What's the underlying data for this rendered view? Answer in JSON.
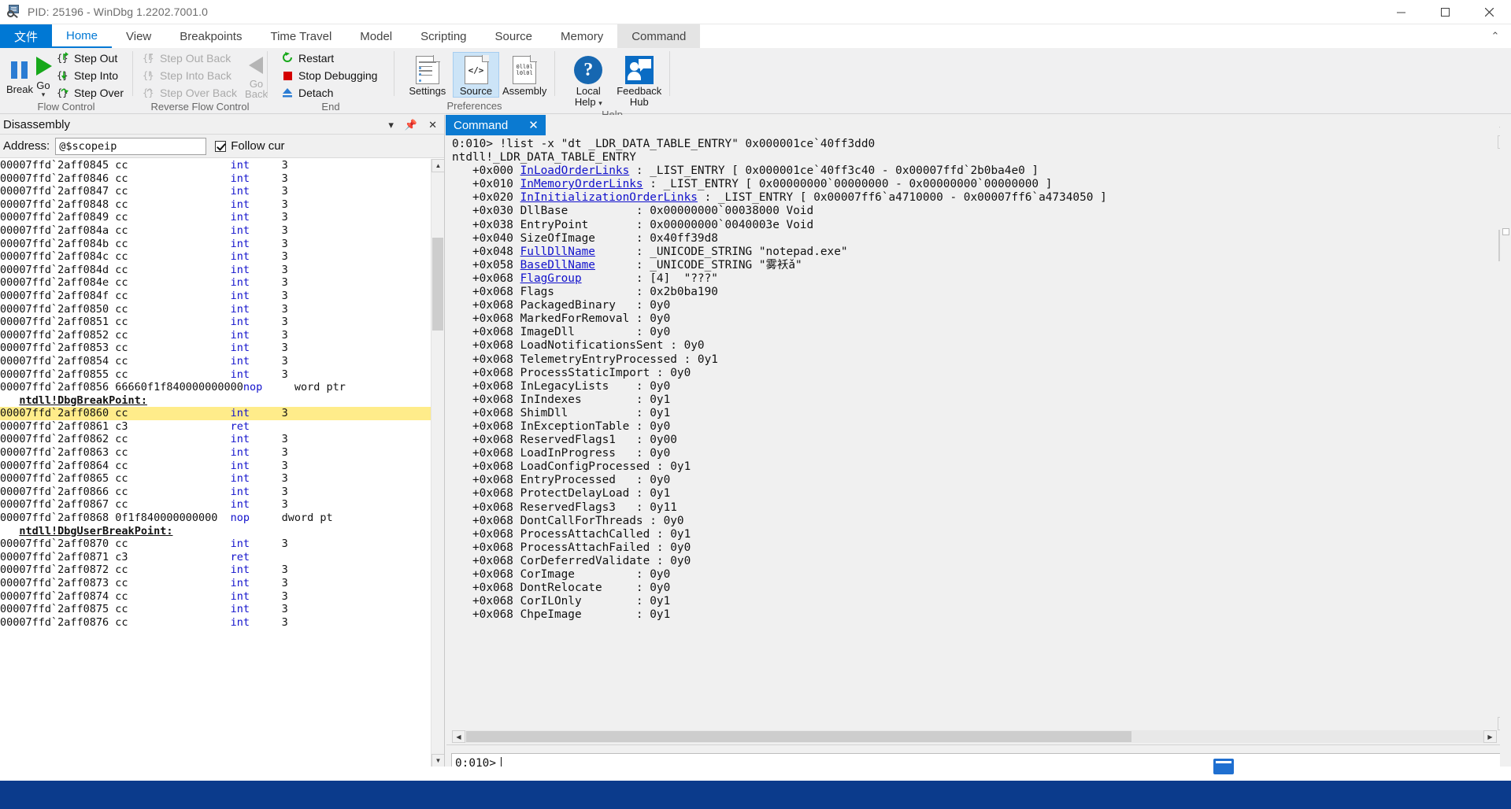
{
  "window": {
    "title": "PID: 25196 - WinDbg 1.2202.7001.0",
    "icon": "windbg-icon",
    "minimize": "minimize-button",
    "maximize": "maximize-button",
    "close": "close-button"
  },
  "ribbon": {
    "file_tab": "文件",
    "tabs": [
      {
        "label": "Home",
        "active": true
      },
      {
        "label": "View",
        "active": false
      },
      {
        "label": "Breakpoints",
        "active": false
      },
      {
        "label": "Time Travel",
        "active": false
      },
      {
        "label": "Model",
        "active": false
      },
      {
        "label": "Scripting",
        "active": false
      },
      {
        "label": "Source",
        "active": false
      },
      {
        "label": "Memory",
        "active": false
      },
      {
        "label": "Command",
        "active": false
      }
    ],
    "groups": [
      {
        "label": "Flow Control",
        "big": [
          {
            "label": "Break",
            "icon": "pause-icon",
            "enabled": true
          },
          {
            "label": "Go",
            "icon": "play-icon",
            "enabled": true,
            "dropdown": true
          }
        ],
        "small": [
          {
            "label": "Step Out",
            "icon": "step-out-icon",
            "enabled": true
          },
          {
            "label": "Step Into",
            "icon": "step-into-icon",
            "enabled": true
          },
          {
            "label": "Step Over",
            "icon": "step-over-icon",
            "enabled": true
          }
        ]
      },
      {
        "label": "Reverse Flow Control",
        "small": [
          {
            "label": "Step Out Back",
            "icon": "step-out-back-icon",
            "enabled": false
          },
          {
            "label": "Step Into Back",
            "icon": "step-into-back-icon",
            "enabled": false
          },
          {
            "label": "Step Over Back",
            "icon": "step-over-back-icon",
            "enabled": false
          }
        ],
        "big": [
          {
            "label": "Go Back",
            "icon": "go-back-icon",
            "enabled": false
          }
        ]
      },
      {
        "label": "End",
        "small": [
          {
            "label": "Restart",
            "icon": "restart-icon",
            "enabled": true
          },
          {
            "label": "Stop Debugging",
            "icon": "stop-icon",
            "enabled": true
          },
          {
            "label": "Detach",
            "icon": "detach-icon",
            "enabled": true
          }
        ]
      },
      {
        "label": "Preferences",
        "pbtns": [
          {
            "label": "Settings",
            "icon": "settings-doc-icon",
            "selected": false
          },
          {
            "label": "Source",
            "icon": "source-code-icon",
            "selected": true
          },
          {
            "label": "Assembly",
            "icon": "assembly-binary-icon",
            "selected": false
          }
        ]
      },
      {
        "label": "Help",
        "pbtns": [
          {
            "label": "Local Help",
            "icon": "question-circle-icon",
            "selected": false,
            "dropdown": true
          },
          {
            "label": "Feedback Hub",
            "icon": "feedback-person-icon",
            "selected": false
          }
        ]
      }
    ]
  },
  "disassembly": {
    "pane_title": "Disassembly",
    "actions": {
      "dropdown": "chevron-down-icon",
      "pin": "pin-icon",
      "close": "close-icon"
    },
    "address_label": "Address:",
    "address_value": "@$scopeip",
    "address_placeholder": "",
    "follow_label": "Follow cur",
    "follow_checked": true,
    "lines": [
      {
        "addr": "00007ffd`2aff0845",
        "bytes": "cc",
        "mnemonic": "int",
        "operands": "3",
        "kind": "code"
      },
      {
        "addr": "00007ffd`2aff0846",
        "bytes": "cc",
        "mnemonic": "int",
        "operands": "3",
        "kind": "code"
      },
      {
        "addr": "00007ffd`2aff0847",
        "bytes": "cc",
        "mnemonic": "int",
        "operands": "3",
        "kind": "code"
      },
      {
        "addr": "00007ffd`2aff0848",
        "bytes": "cc",
        "mnemonic": "int",
        "operands": "3",
        "kind": "code"
      },
      {
        "addr": "00007ffd`2aff0849",
        "bytes": "cc",
        "mnemonic": "int",
        "operands": "3",
        "kind": "code"
      },
      {
        "addr": "00007ffd`2aff084a",
        "bytes": "cc",
        "mnemonic": "int",
        "operands": "3",
        "kind": "code"
      },
      {
        "addr": "00007ffd`2aff084b",
        "bytes": "cc",
        "mnemonic": "int",
        "operands": "3",
        "kind": "code"
      },
      {
        "addr": "00007ffd`2aff084c",
        "bytes": "cc",
        "mnemonic": "int",
        "operands": "3",
        "kind": "code"
      },
      {
        "addr": "00007ffd`2aff084d",
        "bytes": "cc",
        "mnemonic": "int",
        "operands": "3",
        "kind": "code"
      },
      {
        "addr": "00007ffd`2aff084e",
        "bytes": "cc",
        "mnemonic": "int",
        "operands": "3",
        "kind": "code"
      },
      {
        "addr": "00007ffd`2aff084f",
        "bytes": "cc",
        "mnemonic": "int",
        "operands": "3",
        "kind": "code"
      },
      {
        "addr": "00007ffd`2aff0850",
        "bytes": "cc",
        "mnemonic": "int",
        "operands": "3",
        "kind": "code"
      },
      {
        "addr": "00007ffd`2aff0851",
        "bytes": "cc",
        "mnemonic": "int",
        "operands": "3",
        "kind": "code"
      },
      {
        "addr": "00007ffd`2aff0852",
        "bytes": "cc",
        "mnemonic": "int",
        "operands": "3",
        "kind": "code"
      },
      {
        "addr": "00007ffd`2aff0853",
        "bytes": "cc",
        "mnemonic": "int",
        "operands": "3",
        "kind": "code"
      },
      {
        "addr": "00007ffd`2aff0854",
        "bytes": "cc",
        "mnemonic": "int",
        "operands": "3",
        "kind": "code"
      },
      {
        "addr": "00007ffd`2aff0855",
        "bytes": "cc",
        "mnemonic": "int",
        "operands": "3",
        "kind": "code"
      },
      {
        "addr": "00007ffd`2aff0856",
        "bytes": "66660f1f840000000000",
        "mnemonic": "nop",
        "operands": "word ptr",
        "kind": "code"
      },
      {
        "symbol": "ntdll!DbgBreakPoint:",
        "kind": "symbol"
      },
      {
        "addr": "00007ffd`2aff0860",
        "bytes": "cc",
        "mnemonic": "int",
        "operands": "3",
        "kind": "code",
        "highlight": true
      },
      {
        "addr": "00007ffd`2aff0861",
        "bytes": "c3",
        "mnemonic": "ret",
        "operands": "",
        "kind": "code"
      },
      {
        "addr": "00007ffd`2aff0862",
        "bytes": "cc",
        "mnemonic": "int",
        "operands": "3",
        "kind": "code"
      },
      {
        "addr": "00007ffd`2aff0863",
        "bytes": "cc",
        "mnemonic": "int",
        "operands": "3",
        "kind": "code"
      },
      {
        "addr": "00007ffd`2aff0864",
        "bytes": "cc",
        "mnemonic": "int",
        "operands": "3",
        "kind": "code"
      },
      {
        "addr": "00007ffd`2aff0865",
        "bytes": "cc",
        "mnemonic": "int",
        "operands": "3",
        "kind": "code"
      },
      {
        "addr": "00007ffd`2aff0866",
        "bytes": "cc",
        "mnemonic": "int",
        "operands": "3",
        "kind": "code"
      },
      {
        "addr": "00007ffd`2aff0867",
        "bytes": "cc",
        "mnemonic": "int",
        "operands": "3",
        "kind": "code"
      },
      {
        "addr": "00007ffd`2aff0868",
        "bytes": "0f1f840000000000",
        "mnemonic": "nop",
        "operands": "dword pt",
        "kind": "code"
      },
      {
        "symbol": "ntdll!DbgUserBreakPoint:",
        "kind": "symbol"
      },
      {
        "addr": "00007ffd`2aff0870",
        "bytes": "cc",
        "mnemonic": "int",
        "operands": "3",
        "kind": "code"
      },
      {
        "addr": "00007ffd`2aff0871",
        "bytes": "c3",
        "mnemonic": "ret",
        "operands": "",
        "kind": "code"
      },
      {
        "addr": "00007ffd`2aff0872",
        "bytes": "cc",
        "mnemonic": "int",
        "operands": "3",
        "kind": "code"
      },
      {
        "addr": "00007ffd`2aff0873",
        "bytes": "cc",
        "mnemonic": "int",
        "operands": "3",
        "kind": "code"
      },
      {
        "addr": "00007ffd`2aff0874",
        "bytes": "cc",
        "mnemonic": "int",
        "operands": "3",
        "kind": "code"
      },
      {
        "addr": "00007ffd`2aff0875",
        "bytes": "cc",
        "mnemonic": "int",
        "operands": "3",
        "kind": "code"
      },
      {
        "addr": "00007ffd`2aff0876",
        "bytes": "cc",
        "mnemonic": "int",
        "operands": "3",
        "kind": "code"
      }
    ]
  },
  "command": {
    "tab_label": "Command",
    "tab_close": "close-icon",
    "prompt": "0:010>",
    "input_value": "",
    "output": [
      {
        "text": "0:010> !list -x \"dt _LDR_DATA_TABLE_ENTRY\" 0x000001ce`40ff3dd0"
      },
      {
        "text": "ntdll!_LDR_DATA_TABLE_ENTRY"
      },
      {
        "pre": "   +0x000 ",
        "link": "InLoadOrderLinks",
        "post": " : _LIST_ENTRY [ 0x000001ce`40ff3c40 - 0x00007ffd`2b0ba4e0 ]"
      },
      {
        "pre": "   +0x010 ",
        "link": "InMemoryOrderLinks",
        "post": " : _LIST_ENTRY [ 0x00000000`00000000 - 0x00000000`00000000 ]"
      },
      {
        "pre": "   +0x020 ",
        "link": "InInitializationOrderLinks",
        "post": " : _LIST_ENTRY [ 0x00007ff6`a4710000 - 0x00007ff6`a4734050 ]"
      },
      {
        "text": "   +0x030 DllBase          : 0x00000000`00038000 Void"
      },
      {
        "text": "   +0x038 EntryPoint       : 0x00000000`0040003e Void"
      },
      {
        "text": "   +0x040 SizeOfImage      : 0x40ff39d8"
      },
      {
        "pre": "   +0x048 ",
        "link": "FullDllName",
        "post": "      : _UNICODE_STRING \"notepad.exe\""
      },
      {
        "pre": "   +0x058 ",
        "link": "BaseDllName",
        "post": "      : _UNICODE_STRING \"雾袄ǎ\""
      },
      {
        "pre": "   +0x068 ",
        "link": "FlagGroup",
        "post": "        : [4]  \"???\""
      },
      {
        "text": "   +0x068 Flags            : 0x2b0ba190"
      },
      {
        "text": "   +0x068 PackagedBinary   : 0y0"
      },
      {
        "text": "   +0x068 MarkedForRemoval : 0y0"
      },
      {
        "text": "   +0x068 ImageDll         : 0y0"
      },
      {
        "text": "   +0x068 LoadNotificationsSent : 0y0"
      },
      {
        "text": "   +0x068 TelemetryEntryProcessed : 0y1"
      },
      {
        "text": "   +0x068 ProcessStaticImport : 0y0"
      },
      {
        "text": "   +0x068 InLegacyLists    : 0y0"
      },
      {
        "text": "   +0x068 InIndexes        : 0y1"
      },
      {
        "text": "   +0x068 ShimDll          : 0y1"
      },
      {
        "text": "   +0x068 InExceptionTable : 0y0"
      },
      {
        "text": "   +0x068 ReservedFlags1   : 0y00"
      },
      {
        "text": "   +0x068 LoadInProgress   : 0y0"
      },
      {
        "text": "   +0x068 LoadConfigProcessed : 0y1"
      },
      {
        "text": "   +0x068 EntryProcessed   : 0y0"
      },
      {
        "text": "   +0x068 ProtectDelayLoad : 0y1"
      },
      {
        "text": "   +0x068 ReservedFlags3   : 0y11"
      },
      {
        "text": "   +0x068 DontCallForThreads : 0y0"
      },
      {
        "text": "   +0x068 ProcessAttachCalled : 0y1"
      },
      {
        "text": "   +0x068 ProcessAttachFailed : 0y0"
      },
      {
        "text": "   +0x068 CorDeferredValidate : 0y0"
      },
      {
        "text": "   +0x068 CorImage         : 0y0"
      },
      {
        "text": "   +0x068 DontRelocate     : 0y0"
      },
      {
        "text": "   +0x068 CorILOnly        : 0y1"
      },
      {
        "text": "   +0x068 ChpeImage        : 0y1"
      }
    ]
  },
  "colors": {
    "accent": "#0078d4",
    "file_tab": "#0078d4",
    "cmd_tab": "#0b7ad1",
    "highlight_row": "#ffec8a",
    "link": "#1111cc",
    "mnemonic": "#1111cc",
    "taskbar": "#0b3b8c"
  }
}
